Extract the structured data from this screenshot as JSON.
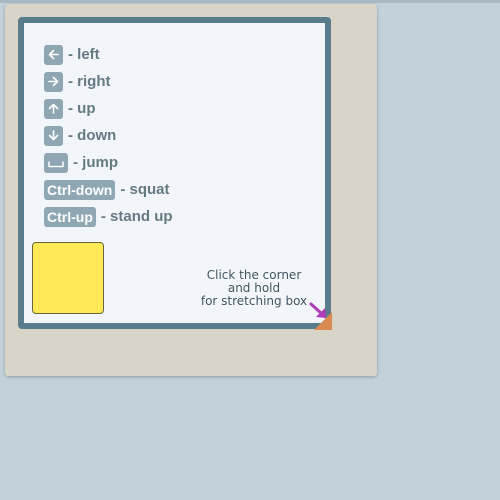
{
  "controls": [
    {
      "key_type": "icon",
      "icon": "arrow-left-icon",
      "label": "- left"
    },
    {
      "key_type": "icon",
      "icon": "arrow-right-icon",
      "label": "- right"
    },
    {
      "key_type": "icon",
      "icon": "arrow-up-icon",
      "label": "- up"
    },
    {
      "key_type": "icon",
      "icon": "arrow-down-icon",
      "label": "- down"
    },
    {
      "key_type": "icon",
      "icon": "spacebar-icon",
      "label": "- jump"
    },
    {
      "key_type": "text",
      "key_text": "Ctrl-down",
      "label": "- squat"
    },
    {
      "key_type": "text",
      "key_text": "Ctrl-up",
      "label": "- stand up"
    }
  ],
  "hint": {
    "line1": "Click the corner",
    "line2": "and hold",
    "line3": "for stretching box"
  },
  "colors": {
    "page_background": "#c2d1da",
    "outer_panel": "#d8d4c8",
    "box_border": "#587c8c",
    "box_background": "#f2f6fa",
    "key_background": "#8ea7b3",
    "label_text": "#667a84",
    "player_block": "#ffe957",
    "resize_handle": "#d98b52",
    "hint_arrow": "#b03ab8"
  }
}
